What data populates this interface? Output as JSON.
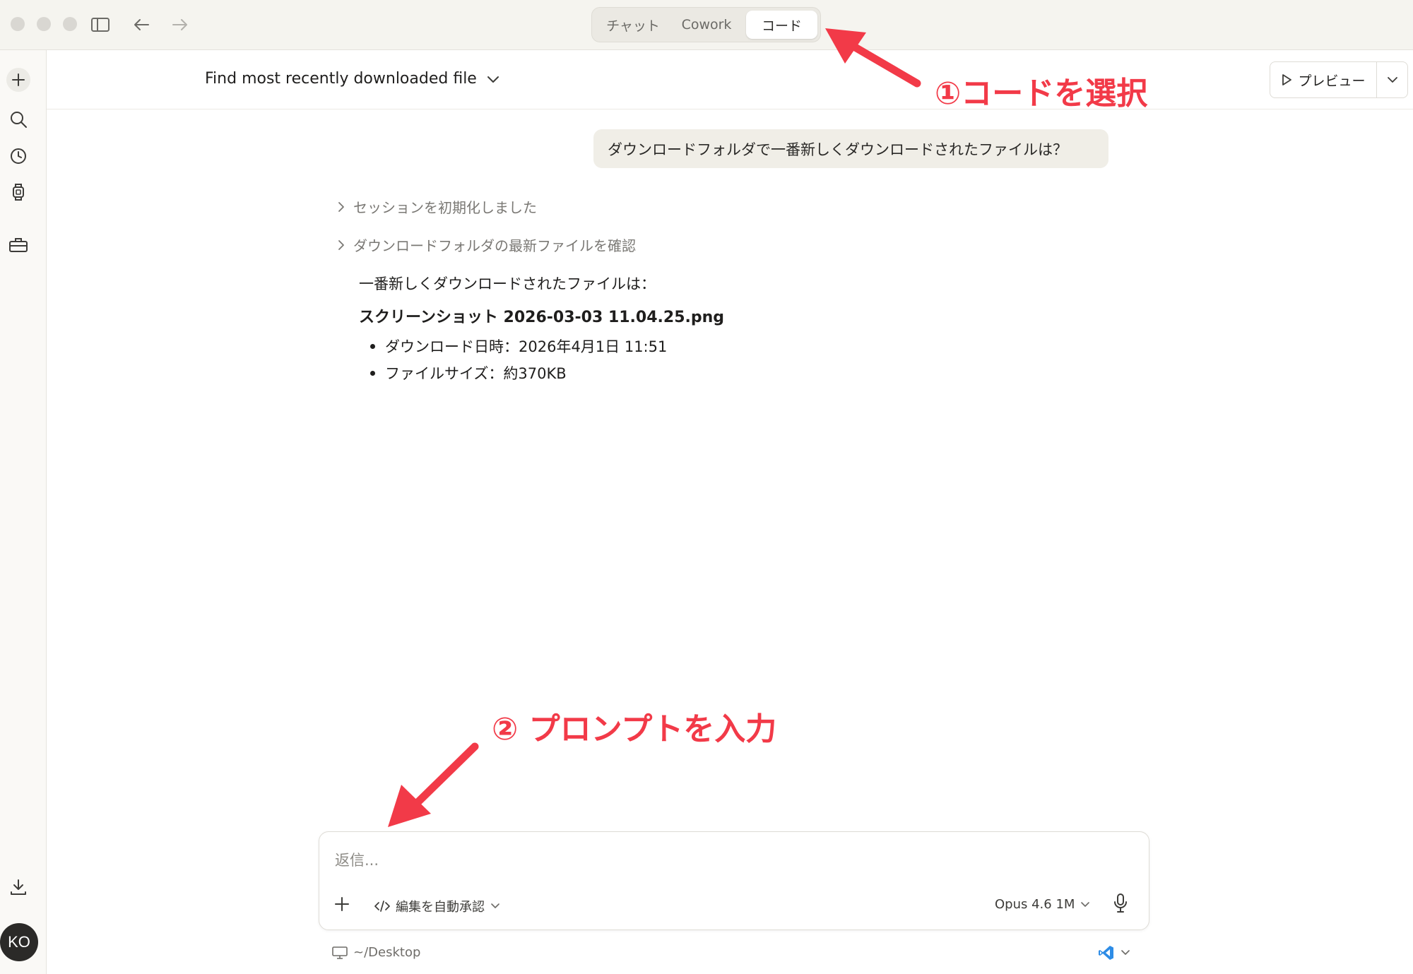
{
  "titlebar": {
    "tabs": [
      {
        "label": "チャット",
        "active": false
      },
      {
        "label": "Cowork",
        "active": false
      },
      {
        "label": "コード",
        "active": true
      }
    ]
  },
  "header": {
    "session_title": "Find most recently downloaded file",
    "preview_label": "プレビュー"
  },
  "conversation": {
    "user_message": "ダウンロードフォルダで一番新しくダウンロードされたファイルは？",
    "steps": [
      "セッションを初期化しました",
      "ダウンロードフォルダの最新ファイルを確認"
    ],
    "reply_intro": "一番新しくダウンロードされたファイルは：",
    "reply_file": "スクリーンショット 2026-03-03 11.04.25.png",
    "reply_bullets": [
      "ダウンロード日時：2026年4月1日 11:51",
      "ファイルサイズ：約370KB"
    ]
  },
  "composer": {
    "placeholder": "返信...",
    "mode_label": "編集を自動承認",
    "model_label": "Opus 4.6 1M"
  },
  "footer": {
    "directory": "~/Desktop"
  },
  "user": {
    "initials": "KO"
  },
  "annotations": {
    "step1": "①コードを選択",
    "step2": "② プロンプトを入力"
  },
  "colors": {
    "annotation": "#f23a48",
    "titlebar_bg": "#f5f4ef",
    "bubble_bg": "#f0eee7",
    "vscode_blue": "#2d8ce6"
  }
}
